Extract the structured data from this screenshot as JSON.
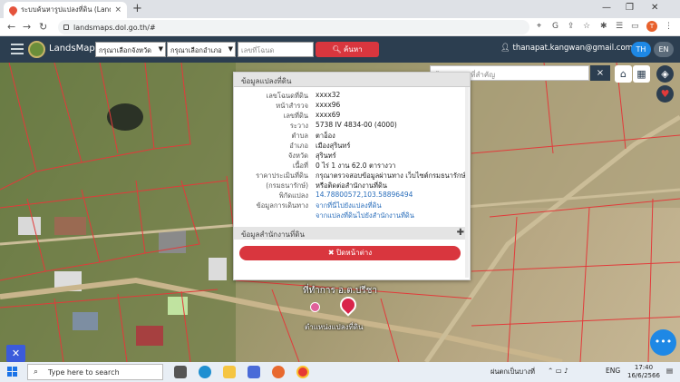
{
  "browser": {
    "tab_title": "ระบบค้นหารูปแปลงที่ดิน (LandsMaps)",
    "url": "landsmaps.dol.go.th/#",
    "profile_initial": "T"
  },
  "header": {
    "brand": "LandsMaps",
    "province_placeholder": "กรุณาเลือกจังหวัด",
    "district_placeholder": "กรุณาเลือกอำเภอ",
    "parcel_placeholder": "เลขที่โฉนด",
    "search_label": "ค้นหา",
    "user_email": "thanapat.kangwan@gmail.com",
    "lang_th": "TH",
    "lang_en": "EN"
  },
  "map_search": {
    "placeholder": "ค้นหาสถานที่สำคัญ",
    "close": "×"
  },
  "panel": {
    "title": "ข้อมูลแปลงที่ดิน",
    "rows": [
      {
        "key": "เลขโฉนดที่ดิน",
        "value": "xxxx32"
      },
      {
        "key": "หน้าสำรวจ",
        "value": "xxxx96"
      },
      {
        "key": "เลขที่ดิน",
        "value": "xxxx69"
      },
      {
        "key": "ระวาง",
        "value": "5738 IV 4834-00 (4000)"
      },
      {
        "key": "ตำบล",
        "value": "ตาอ็อง"
      },
      {
        "key": "อำเภอ",
        "value": "เมืองสุรินทร์"
      },
      {
        "key": "จังหวัด",
        "value": "สุรินทร์"
      },
      {
        "key": "เนื้อที่",
        "value": "0 ไร่ 1 งาน 62.0 ตารางวา"
      },
      {
        "key": "ราคาประเมินที่ดิน",
        "value": "กรุณาตรวจสอบข้อมูลผ่านทาง เว็บไซต์กรมธนารักษ์"
      },
      {
        "key": "(กรมธนารักษ์)",
        "value": "หรือติดต่อสำนักงานที่ดิน"
      },
      {
        "key": "พิกัดแปลง",
        "value": "14.78800572,103.58896494"
      },
      {
        "key": "ข้อมูลการเดินทาง",
        "value": "จากที่นี่ไปยังแปลงที่ดิน"
      },
      {
        "key": "",
        "value": "จากแปลงที่ดินไปยังสำนักงานที่ดิน"
      }
    ],
    "office_header": "ข้อมูลสำนักงานที่ดิน",
    "close_label": "✖ ปิดหน้าต่าง"
  },
  "map_labels": {
    "office": "ที่ทำการ อ.ต.ปรีชา",
    "parcel": "ตำแหน่งแปลงที่ดิน"
  },
  "taskbar": {
    "search_placeholder": "Type here to search",
    "weather": "ฝนตกเป็นบางที่",
    "lang": "ENG",
    "time": "17:40",
    "date": "16/6/2566"
  }
}
